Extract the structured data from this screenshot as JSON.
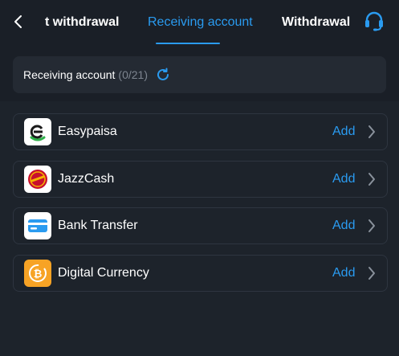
{
  "header": {
    "tabs": [
      {
        "label": "t withdrawal"
      },
      {
        "label": "Receiving account"
      },
      {
        "label": "Withdrawal l"
      }
    ],
    "active_tab": "Receiving account",
    "icons": {
      "back": "chevron-left-icon",
      "support": "headset-icon"
    }
  },
  "summary": {
    "title": "Receiving account",
    "count": "(0/21)",
    "icon": "refresh-icon"
  },
  "accounts": [
    {
      "label": "Easypaisa",
      "action": "Add",
      "icon": "easypaisa-logo"
    },
    {
      "label": "JazzCash",
      "action": "Add",
      "icon": "jazzcash-logo"
    },
    {
      "label": "Bank Transfer",
      "action": "Add",
      "icon": "bank-card-icon"
    },
    {
      "label": "Digital Currency",
      "action": "Add",
      "icon": "bitcoin-icon"
    }
  ],
  "colors": {
    "accent": "#2a9bf0",
    "background": "#1a1f27",
    "card": "#242a33",
    "bitcoin": "#f7a325"
  }
}
